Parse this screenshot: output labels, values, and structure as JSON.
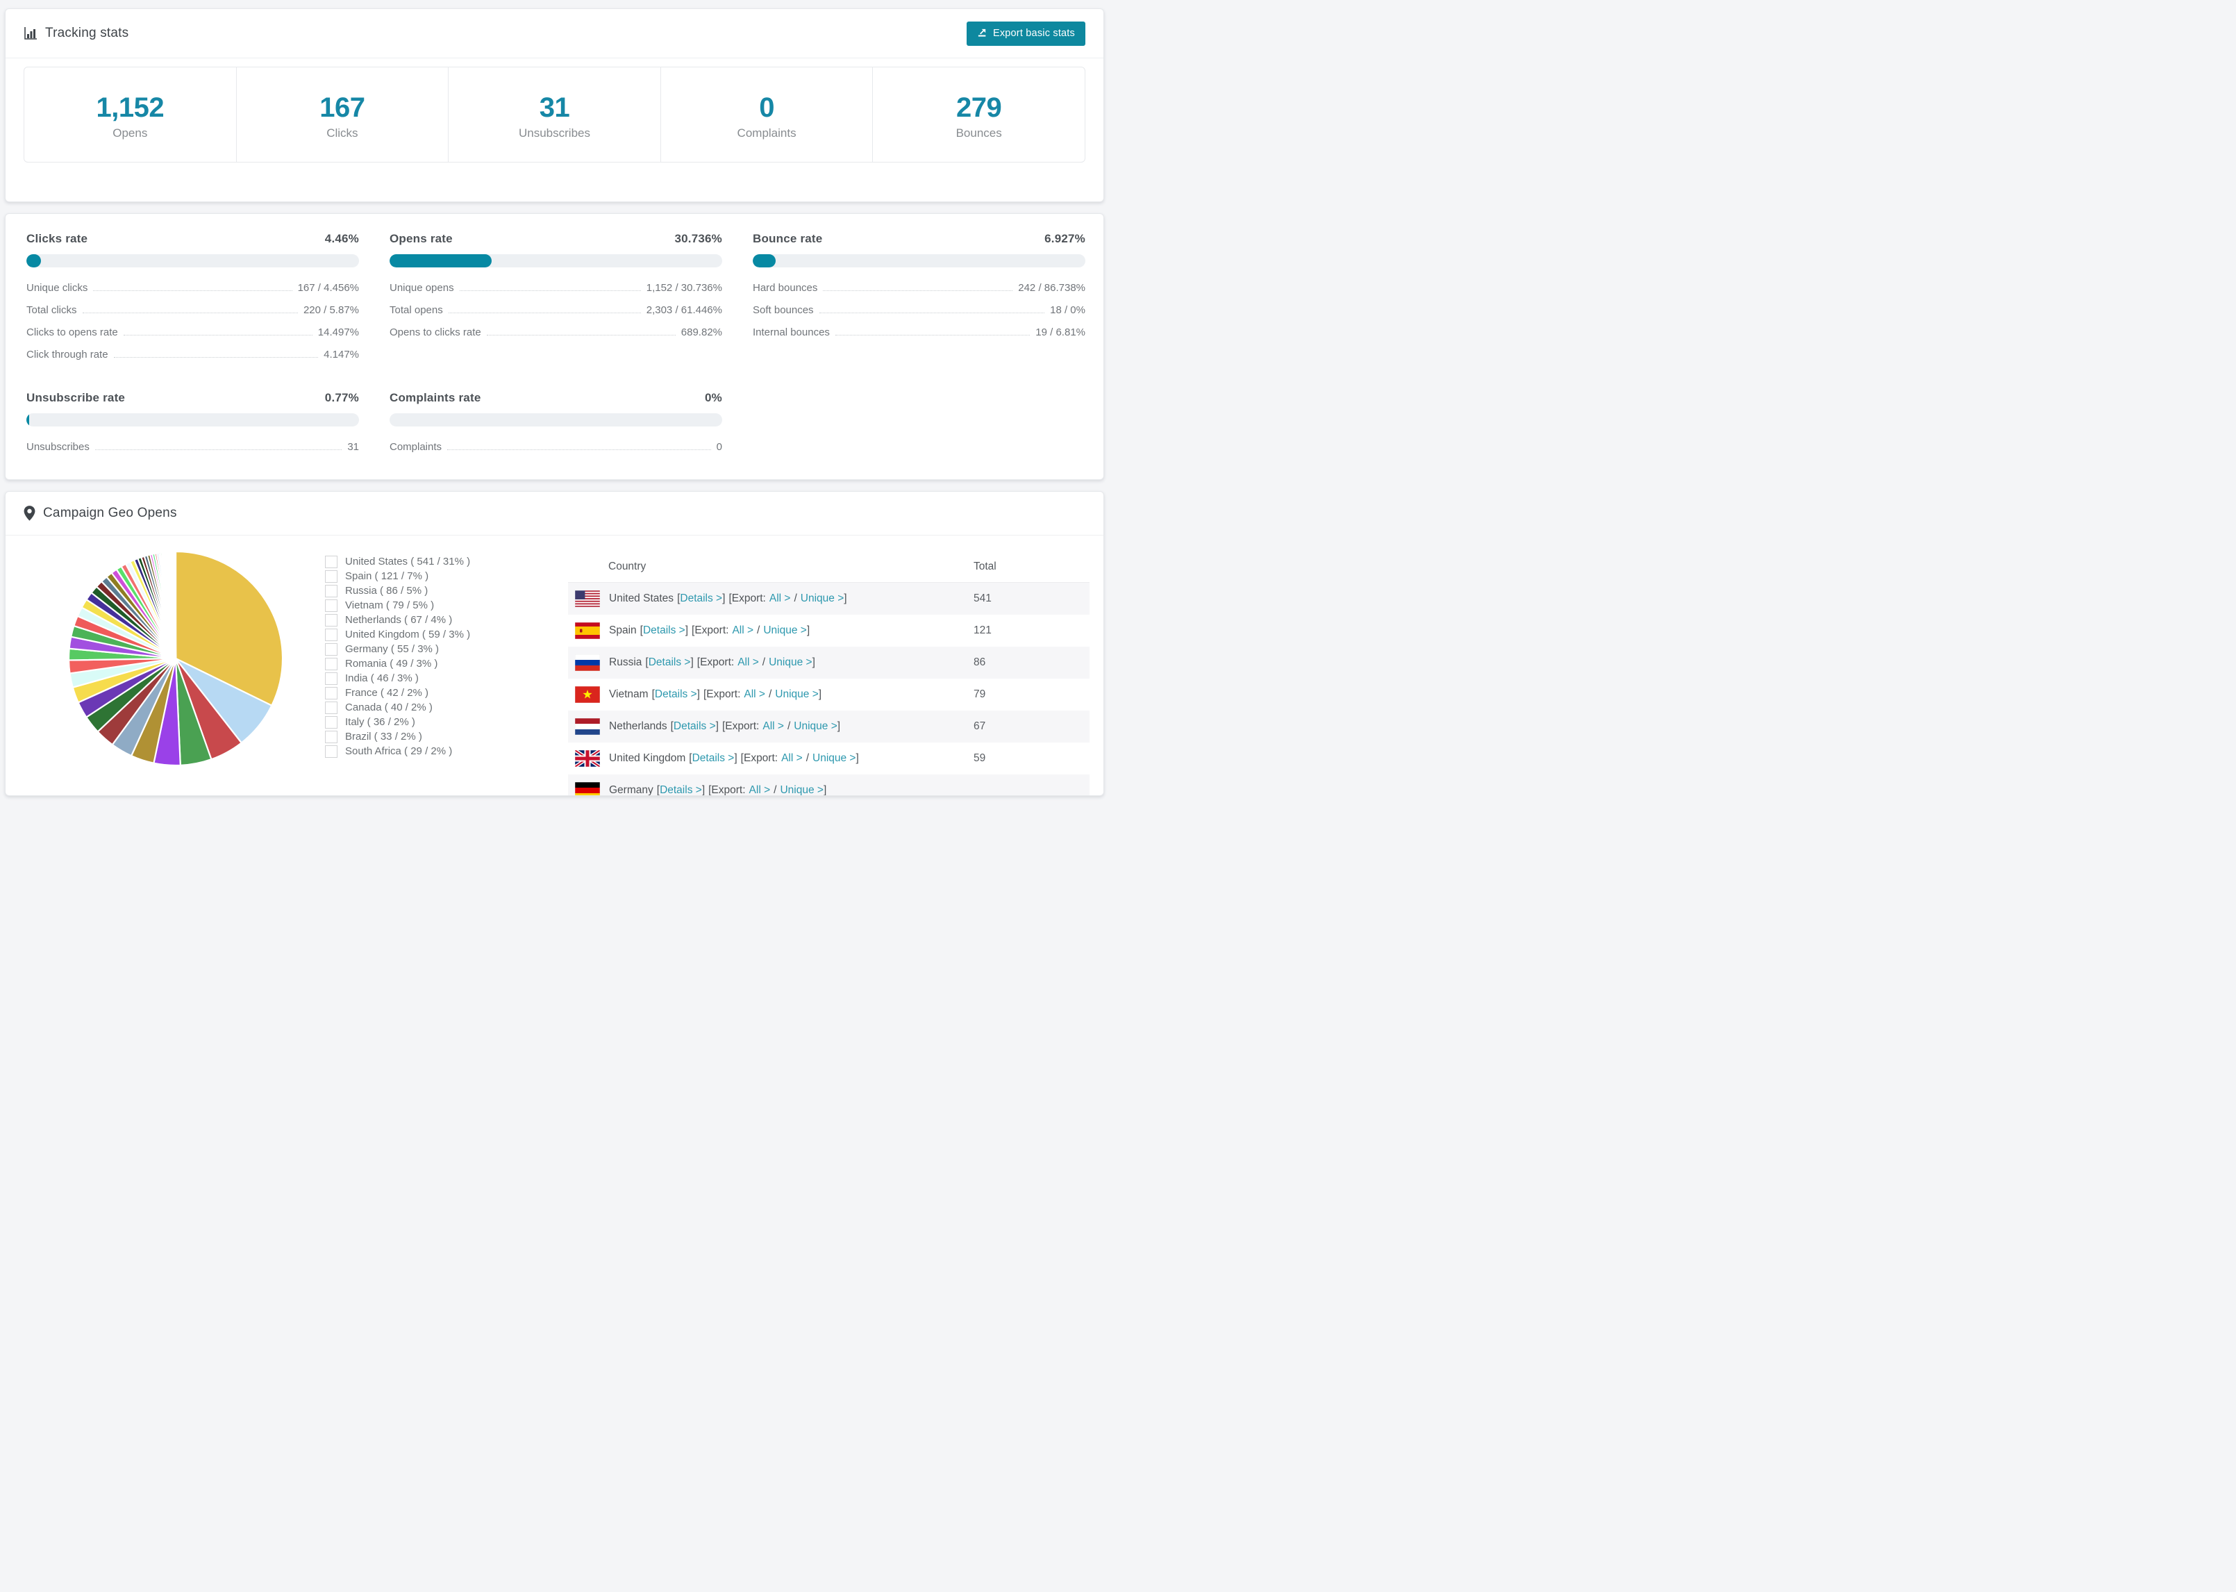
{
  "page": {
    "background": "#f4f5f7"
  },
  "colors": {
    "accent_bar": "#0789a3",
    "button": "#0e889f",
    "link": "#2d98ae",
    "big_number": "#1687a6",
    "bar_track": "#edf0f3",
    "card_border": "#e6e8eb",
    "row_stripe": "#f6f6f8"
  },
  "tracking": {
    "title": "Tracking stats",
    "export_label": "Export basic stats",
    "stats": [
      {
        "value": "1,152",
        "label": "Opens"
      },
      {
        "value": "167",
        "label": "Clicks"
      },
      {
        "value": "31",
        "label": "Unsubscribes"
      },
      {
        "value": "0",
        "label": "Complaints"
      },
      {
        "value": "279",
        "label": "Bounces"
      }
    ]
  },
  "rates": {
    "panels": [
      {
        "name": "Clicks rate",
        "value": "4.46%",
        "percent": 4.46,
        "rows": [
          {
            "label": "Unique clicks",
            "value": "167 / 4.456%"
          },
          {
            "label": "Total clicks",
            "value": "220 / 5.87%"
          },
          {
            "label": "Clicks to opens rate",
            "value": "14.497%"
          },
          {
            "label": "Click through rate",
            "value": "4.147%"
          }
        ]
      },
      {
        "name": "Opens rate",
        "value": "30.736%",
        "percent": 30.736,
        "rows": [
          {
            "label": "Unique opens",
            "value": "1,152 / 30.736%"
          },
          {
            "label": "Total opens",
            "value": "2,303 / 61.446%"
          },
          {
            "label": "Opens to clicks rate",
            "value": "689.82%"
          }
        ]
      },
      {
        "name": "Bounce rate",
        "value": "6.927%",
        "percent": 6.927,
        "rows": [
          {
            "label": "Hard bounces",
            "value": "242 / 86.738%"
          },
          {
            "label": "Soft bounces",
            "value": "18 / 0%"
          },
          {
            "label": "Internal bounces",
            "value": "19 / 6.81%"
          }
        ]
      },
      {
        "name": "Unsubscribe rate",
        "value": "0.77%",
        "percent": 0.77,
        "rows": [
          {
            "label": "Unsubscribes",
            "value": "31"
          }
        ]
      },
      {
        "name": "Complaints rate",
        "value": "0%",
        "percent": 0,
        "rows": [
          {
            "label": "Complaints",
            "value": "0"
          }
        ]
      }
    ]
  },
  "geo": {
    "title": "Campaign Geo Opens",
    "columns": {
      "country": "Country",
      "total": "Total"
    },
    "fragments": {
      "b1": "[",
      "b2": "]",
      "b3": "[Export:",
      "slash": "/",
      "b4": "]"
    },
    "links": {
      "details": "Details >",
      "all": "All >",
      "unique": "Unique >"
    },
    "rows": [
      {
        "country": "United States",
        "total": "541"
      },
      {
        "country": "Spain",
        "total": "121"
      },
      {
        "country": "Russia",
        "total": "86"
      },
      {
        "country": "Vietnam",
        "total": "79"
      },
      {
        "country": "Netherlands",
        "total": "67"
      },
      {
        "country": "United Kingdom",
        "total": "59"
      },
      {
        "country": "Germany",
        "total": ""
      }
    ]
  },
  "chart_data": {
    "type": "pie",
    "title": "Campaign Geo Opens",
    "legend_position": "right",
    "start_angle_deg": -90,
    "direction": "clockwise",
    "labeled": [
      {
        "name": "United States",
        "value": 541,
        "pct": "31%",
        "label": "United States ( 541 / 31% )",
        "color": "#e8c24a"
      },
      {
        "name": "Spain",
        "value": 121,
        "pct": "7%",
        "label": "Spain ( 121 / 7% )",
        "color": "#b7d9f3"
      },
      {
        "name": "Russia",
        "value": 86,
        "pct": "5%",
        "label": "Russia ( 86 / 5% )",
        "color": "#c8494c"
      },
      {
        "name": "Vietnam",
        "value": 79,
        "pct": "5%",
        "label": "Vietnam ( 79 / 5% )",
        "color": "#4aa152"
      },
      {
        "name": "Netherlands",
        "value": 67,
        "pct": "4%",
        "label": "Netherlands ( 67 / 4% )",
        "color": "#9a41e8"
      },
      {
        "name": "United Kingdom",
        "value": 59,
        "pct": "3%",
        "label": "United Kingdom ( 59 / 3% )",
        "color": "#b09134"
      },
      {
        "name": "Germany",
        "value": 55,
        "pct": "3%",
        "label": "Germany ( 55 / 3% )",
        "color": "#8fabc5"
      },
      {
        "name": "Romania",
        "value": 49,
        "pct": "3%",
        "label": "Romania ( 49 / 3% )",
        "color": "#9e3b3b"
      },
      {
        "name": "India",
        "value": 46,
        "pct": "3%",
        "label": "India ( 46 / 3% )",
        "color": "#2e7434"
      },
      {
        "name": "France",
        "value": 42,
        "pct": "2%",
        "label": "France ( 42 / 2% )",
        "color": "#6b38b5"
      },
      {
        "name": "Canada",
        "value": 40,
        "pct": "2%",
        "label": "Canada ( 40 / 2% )",
        "color": "#f6dc4d"
      },
      {
        "name": "Italy",
        "value": 36,
        "pct": "2%",
        "label": "Italy ( 36 / 2% )",
        "color": "#d9fbf7"
      },
      {
        "name": "Brazil",
        "value": 33,
        "pct": "2%",
        "label": "Brazil ( 33 / 2% )",
        "color": "#f2605e"
      },
      {
        "name": "South Africa",
        "value": 29,
        "pct": "2%",
        "label": "South Africa ( 29 / 2% )",
        "color": "#57ca62"
      }
    ],
    "others_values": [
      30,
      28,
      26,
      24,
      23,
      21,
      20,
      18,
      17,
      16,
      15,
      14,
      13,
      12,
      11,
      10,
      9,
      8,
      8,
      7,
      6,
      6,
      5,
      5,
      4,
      4,
      3,
      3,
      3,
      2,
      2,
      2,
      2,
      2,
      1.6,
      1.4,
      1.2,
      1,
      1,
      1,
      0.9,
      0.8,
      0.7,
      0.7,
      0.6,
      0.6,
      0.5,
      0.5,
      0.4,
      0.4,
      0.35,
      0.3,
      0.3,
      0.25,
      0.25,
      0.2,
      0.2,
      0.2,
      0.15,
      0.15
    ],
    "others_palette": [
      "#a24fe0",
      "#4cb357",
      "#ef5a5a",
      "#dcfbf8",
      "#f4e04e",
      "#44309a",
      "#1f5c28",
      "#7c2a2a",
      "#5d7d92",
      "#8f7d22",
      "#ce4fd8",
      "#59e06b",
      "#f07070",
      "#eef8ff",
      "#f6ef61",
      "#342a7e",
      "#17501f",
      "#6f2525",
      "#4f6c7e",
      "#6e6421",
      "#df54de",
      "#54e083",
      "#e04848",
      "#bcd9f2"
    ]
  }
}
